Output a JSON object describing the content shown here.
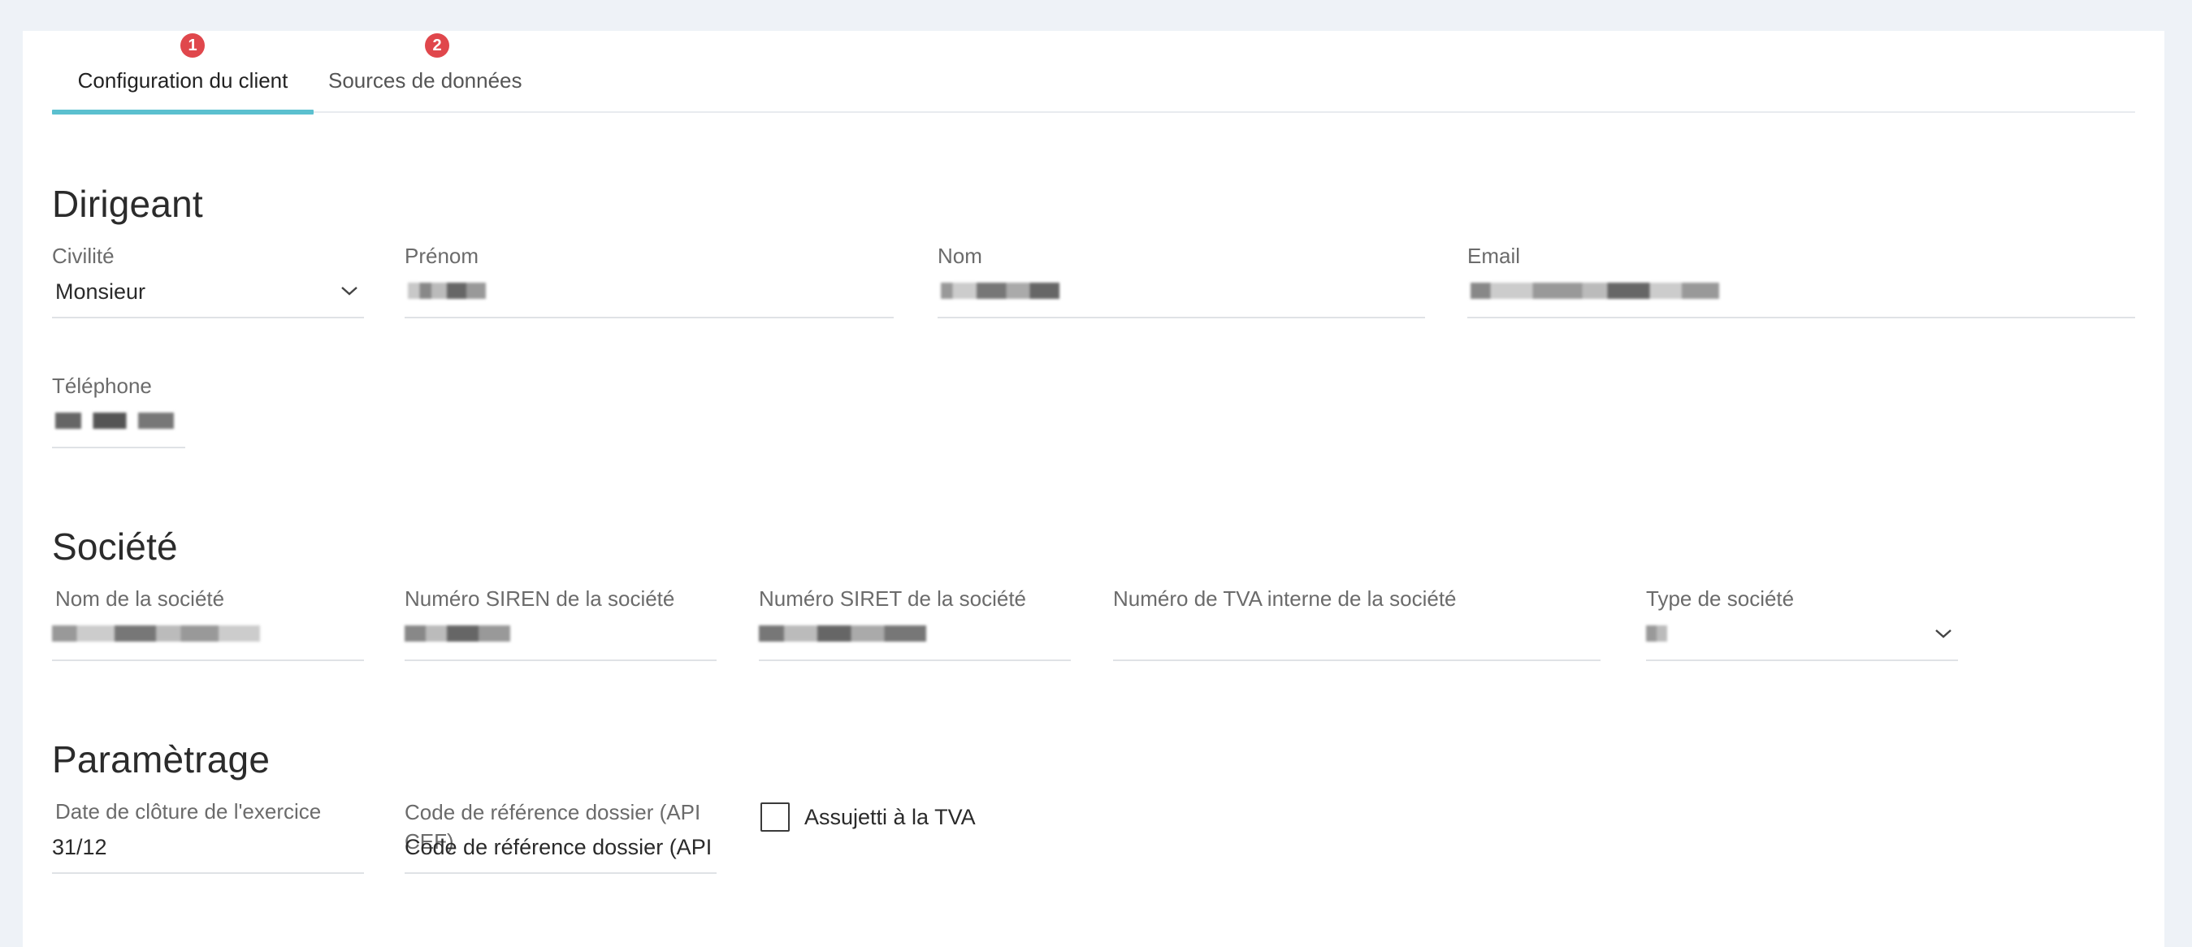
{
  "tabs": [
    {
      "label": "Configuration du client",
      "badge": "1",
      "active": true
    },
    {
      "label": "Sources de données",
      "badge": "2",
      "active": false
    }
  ],
  "dirigeant": {
    "title": "Dirigeant",
    "civilite": {
      "label": "Civilité",
      "value": "Monsieur"
    },
    "prenom": {
      "label": "Prénom"
    },
    "nom": {
      "label": "Nom"
    },
    "email": {
      "label": "Email"
    },
    "telephone": {
      "label": "Téléphone"
    }
  },
  "societe": {
    "title": "Société",
    "nom": {
      "label": "Nom de la société"
    },
    "siren": {
      "label": "Numéro SIREN de la société"
    },
    "siret": {
      "label": "Numéro SIRET de la société"
    },
    "tva": {
      "label": "Numéro de TVA interne de la société"
    },
    "type": {
      "label": "Type de société"
    }
  },
  "parametrage": {
    "title": "Paramètrage",
    "cloture": {
      "label": "Date de clôture de l'exercice",
      "value": "31/12"
    },
    "code_ref": {
      "label": "Code de référence dossier (API CEF)",
      "placeholder": "Code de référence dossier (API C"
    },
    "tva_checkbox": {
      "label": "Assujetti à la TVA",
      "checked": false
    }
  },
  "colors": {
    "accent": "#5bc0cf",
    "badge": "#e0474c"
  },
  "icons": {
    "dropdown": "chevron-down-icon"
  }
}
